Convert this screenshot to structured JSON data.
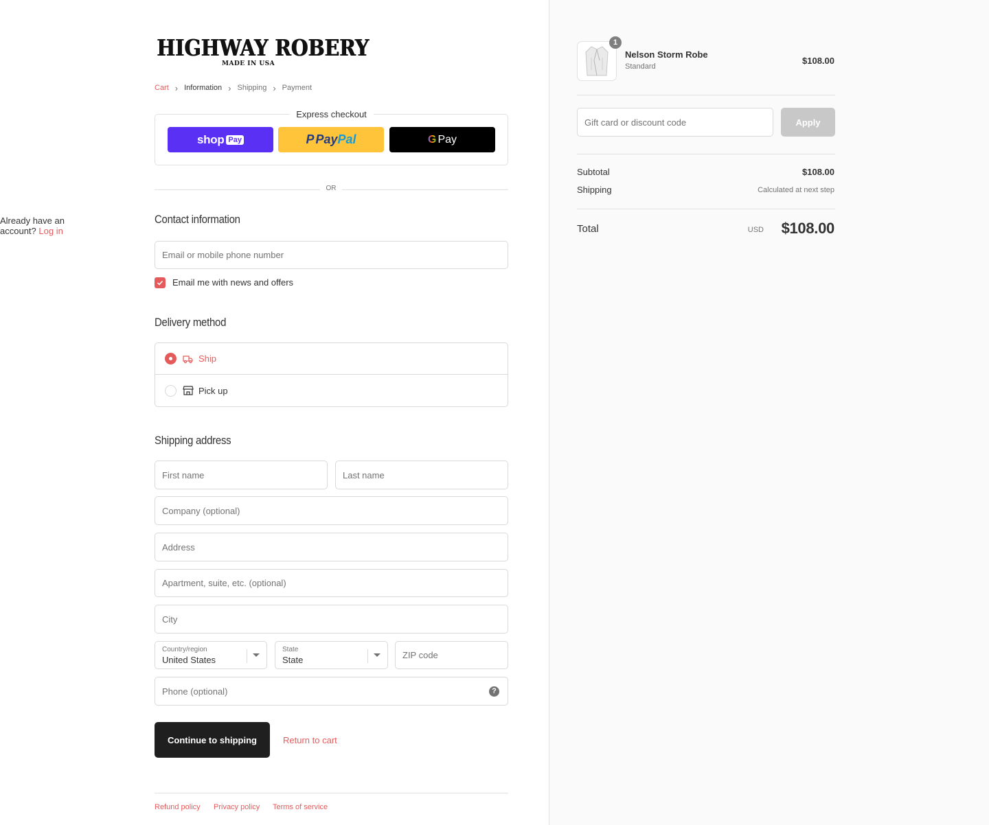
{
  "brand": {
    "name": "HIGHWAY ROBERY",
    "tagline": "MADE IN USA"
  },
  "breadcrumb": [
    {
      "label": "Cart",
      "state": "link"
    },
    {
      "label": "Information",
      "state": "current"
    },
    {
      "label": "Shipping",
      "state": "upcoming"
    },
    {
      "label": "Payment",
      "state": "upcoming"
    }
  ],
  "express": {
    "title": "Express checkout",
    "shop_pay": {
      "word": "shop",
      "badge": "Pay"
    },
    "paypal": {
      "word_a": "Pay",
      "word_b": "Pal"
    },
    "gpay": {
      "g": "G",
      "word": "Pay"
    }
  },
  "or_label": "OR",
  "contact": {
    "title": "Contact information",
    "account_prompt": "Already have an account?",
    "login_label": "Log in",
    "email_placeholder": "Email or mobile phone number",
    "newsletter_label": "Email me with news and offers",
    "newsletter_checked": true
  },
  "delivery": {
    "title": "Delivery method",
    "options": [
      {
        "label": "Ship",
        "selected": true
      },
      {
        "label": "Pick up",
        "selected": false
      }
    ]
  },
  "shipping_address": {
    "title": "Shipping address",
    "first_name": "First name",
    "last_name": "Last name",
    "company": "Company (optional)",
    "address": "Address",
    "apartment": "Apartment, suite, etc. (optional)",
    "city": "City",
    "country_label": "Country/region",
    "country_value": "United States",
    "state_label": "State",
    "state_value": "State",
    "zip": "ZIP code",
    "phone": "Phone (optional)",
    "help_glyph": "?"
  },
  "actions": {
    "continue": "Continue to shipping",
    "return": "Return to cart"
  },
  "footer": [
    "Refund policy",
    "Privacy policy",
    "Terms of service"
  ],
  "summary": {
    "item": {
      "name": "Nelson Storm Robe",
      "variant": "Standard",
      "price": "$108.00",
      "quantity": "1"
    },
    "discount_placeholder": "Gift card or discount code",
    "apply_label": "Apply",
    "subtotal_label": "Subtotal",
    "subtotal_value": "$108.00",
    "shipping_label": "Shipping",
    "shipping_value": "Calculated at next step",
    "total_label": "Total",
    "currency": "USD",
    "total_value": "$108.00"
  },
  "colors": {
    "accent": "#e55b5b",
    "shop_pay": "#5a31f4",
    "paypal": "#ffc439",
    "gpay": "#000000",
    "button_dark": "#1f1f1f"
  }
}
